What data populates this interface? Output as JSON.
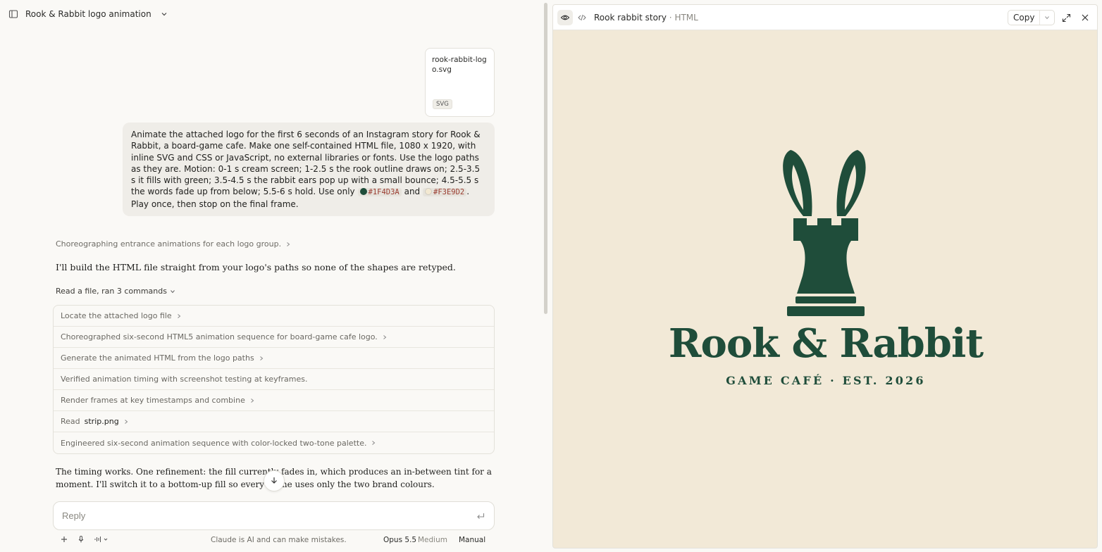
{
  "conversation": {
    "title": "Rook & Rabbit logo animation"
  },
  "attachment": {
    "filename": "rook-rabbit-logo.svg",
    "type": "SVG"
  },
  "user_message": {
    "part1": "Animate the attached logo for the first 6 seconds of an Instagram story for Rook & Rabbit, a board-game cafe. Make one self-contained HTML file, 1080 x 1920, with inline SVG and CSS or JavaScript, no external libraries or fonts. Use the logo paths as they are. Motion: 0-1 s cream screen; 1-2.5 s the rook outline draws on; 2.5-3.5 s it fills with green; 3.5-4.5 s the rabbit ears pop up with a small bounce; 4.5-5.5 s the words fade up from below; 5.5-6 s hold. Use only",
    "color1": "#1F4D3A",
    "and": "and",
    "color2": "#F3E9D2",
    "part2": ". Play once, then stop on the final frame."
  },
  "thinking_summary": "Choreographing entrance animations for each logo group.",
  "assistant_intro": "I'll build the HTML file straight from your logo's paths so none of the shapes are retyped.",
  "tools_summary": "Read a file, ran 3 commands",
  "steps": [
    {
      "text": "Locate the attached logo file",
      "expandable": true
    },
    {
      "text": "Choreographed six-second HTML5 animation sequence for board-game cafe logo.",
      "expandable": true
    },
    {
      "text": "Generate the animated HTML from the logo paths",
      "expandable": true
    },
    {
      "text": "Verified animation timing with screenshot testing at keyframes.",
      "expandable": false
    },
    {
      "text": "Render frames at key timestamps and combine",
      "expandable": true
    },
    {
      "text": "Read",
      "file": "strip.png",
      "expandable": true
    },
    {
      "text": "Engineered six-second animation sequence with color-locked two-tone palette.",
      "expandable": true
    }
  ],
  "assistant_followup": "The timing works. One refinement: the fill currently fades in, which produces an in-between tint for a moment. I'll switch it to a bottom-up fill so every frame uses only the two brand colours.",
  "composer": {
    "placeholder": "Reply"
  },
  "footer": {
    "disclaimer": "Claude is AI and can make mistakes.",
    "model": "Opus 5.5",
    "effort": "Medium",
    "mode": "Manual"
  },
  "artifact": {
    "title": "Rook rabbit story",
    "type": "HTML",
    "copy_label": "Copy"
  },
  "logo": {
    "name": "Rook & Rabbit",
    "tagline": "GAME CAFÉ · EST. 2026",
    "primary_color": "#1F4D3A",
    "background_color": "#F3E9D2"
  },
  "colors": {
    "accent_green": "#1F4D3A",
    "cream": "#F3E9D2",
    "page_bg": "#FAF9F6"
  }
}
